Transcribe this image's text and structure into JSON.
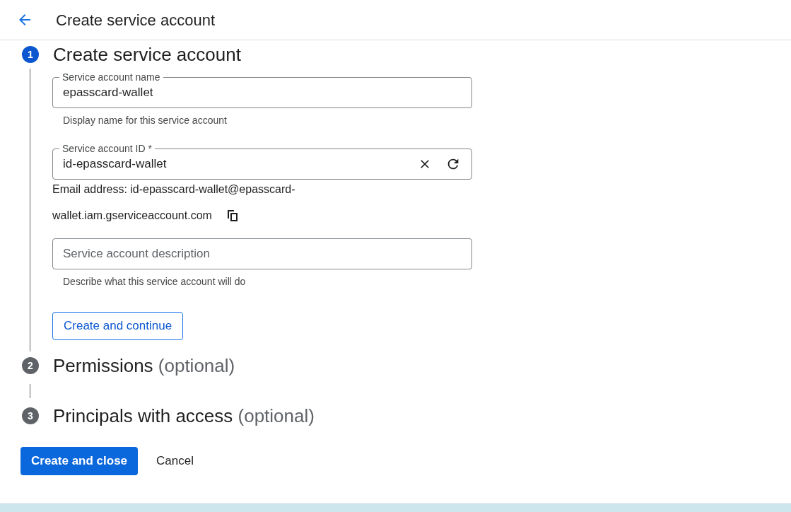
{
  "header": {
    "title": "Create service account"
  },
  "steps": [
    {
      "number": "1",
      "title": "Create service account",
      "active": true
    },
    {
      "number": "2",
      "title": "Permissions",
      "suffix": "(optional)",
      "active": false
    },
    {
      "number": "3",
      "title": "Principals with access",
      "suffix": "(optional)",
      "active": false
    }
  ],
  "form": {
    "name_field": {
      "label": "Service account name",
      "value": "epasscard-wallet",
      "hint": "Display name for this service account"
    },
    "id_field": {
      "label": "Service account ID *",
      "value": "id-epasscard-wallet"
    },
    "email": {
      "line_1": "Email address: id-epasscard-wallet@epasscard-",
      "line_2": "wallet.iam.gserviceaccount.com"
    },
    "description_field": {
      "placeholder": "Service account description",
      "hint": "Describe what this service account will do"
    },
    "continue_button": "Create and continue"
  },
  "buttons": {
    "primary": "Create and close",
    "secondary": "Cancel"
  }
}
